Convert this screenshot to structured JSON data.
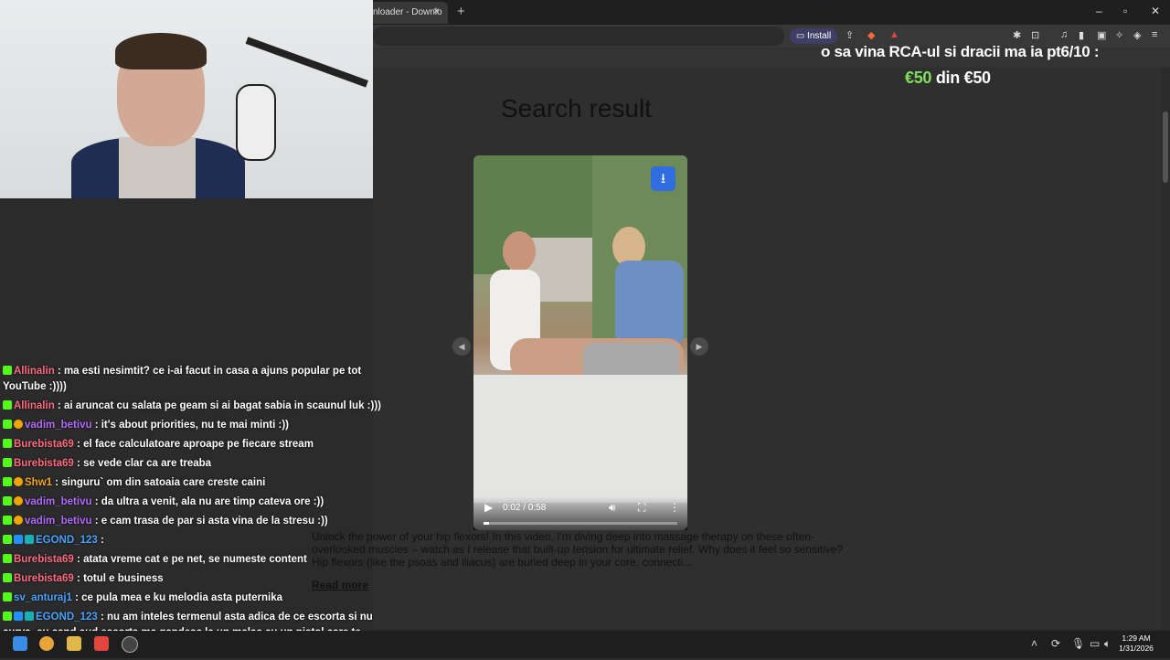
{
  "browser": {
    "tab_title": "nloader - Downlo",
    "tab_close": "×",
    "new_tab": "+",
    "window_controls": {
      "minimize": "–",
      "maximize": "▫",
      "close": "✕"
    },
    "install_label": "Install",
    "icons": [
      "share-icon",
      "brave-shields-icon",
      "brave-rewards-icon",
      "extensions-icon",
      "media-icon",
      "sidebar-icon",
      "wallet-icon",
      "leo-icon",
      "vpn-icon",
      "menu-icon"
    ]
  },
  "page": {
    "search_title": "Search result",
    "video": {
      "time": "0:02 / 0:58",
      "progress": 0.03,
      "download_icon": "download-icon"
    },
    "description": "Unlock the power of your hip flexors! In this video, I'm diving deep into massage therapy on these often-overlooked muscles – watch as I release that built-up tension for ultimate relief. Why does it feel so sensitive? Hip flexors (like the psoas and iliacus) are buried deep in your core, connecti...",
    "read_more": "Read more"
  },
  "overlay": {
    "donation_title": "o sa vina RCA-ul si dracii ma ia pt6/10 :",
    "donation_current": "€50",
    "donation_mid": " din ",
    "donation_goal": "€50"
  },
  "chat": [
    {
      "badges": [
        "k"
      ],
      "user": "Allinalin",
      "color": "#ff6b81",
      "text": " : ma esti nesimtit? ce i-ai facut in casa a ajuns popular pe tot YouTube :))))"
    },
    {
      "badges": [
        "k"
      ],
      "user": "Allinalin",
      "color": "#ff6b81",
      "text": " : ai aruncat cu salata pe geam si ai bagat sabia in scaunul luk :)))"
    },
    {
      "badges": [
        "k",
        "o"
      ],
      "user": "vadim_betivu",
      "color": "#b36bff",
      "text": " : it's about priorities, nu te mai minti :))"
    },
    {
      "badges": [
        "k"
      ],
      "user": "Burebista69",
      "color": "#ff6b81",
      "text": " : el face calculatoare aproape pe fiecare stream"
    },
    {
      "badges": [
        "k"
      ],
      "user": "Burebista69",
      "color": "#ff6b81",
      "text": " : se vede clar ca are treaba"
    },
    {
      "badges": [
        "k",
        "o"
      ],
      "user": "Shw1",
      "color": "#f5a623",
      "text": " : singuru` om din satoaia care creste caini"
    },
    {
      "badges": [
        "k",
        "o"
      ],
      "user": "vadim_betivu",
      "color": "#b36bff",
      "text": " : da ultra a venit, ala nu are timp cateva ore :))"
    },
    {
      "badges": [
        "k",
        "o"
      ],
      "user": "vadim_betivu",
      "color": "#b36bff",
      "text": " : e cam trasa de par si asta vina de la stresu :))"
    },
    {
      "badges": [
        "k",
        "b",
        "t"
      ],
      "user": "EGOND_123",
      "color": "#4aa3ff",
      "text": " : "
    },
    {
      "badges": [
        "k"
      ],
      "user": "Burebista69",
      "color": "#ff6b81",
      "text": " : atata vreme cat e pe net, se numeste content"
    },
    {
      "badges": [
        "k"
      ],
      "user": "Burebista69",
      "color": "#ff6b81",
      "text": " : totul e business"
    },
    {
      "badges": [
        "k"
      ],
      "user": "sv_anturaj1",
      "color": "#4aa3ff",
      "text": " : ce pula mea e ku melodia asta puternika"
    },
    {
      "badges": [
        "k",
        "b",
        "t"
      ],
      "user": "EGOND_123",
      "color": "#4aa3ff",
      "text": " : nu am inteles termenul asta adica de ce escorta si nu curva. eu cand aud escorta ma gandesc la un malac cu un pistol care te apara. da asta ce escorta ca e curva"
    }
  ],
  "taskbar": {
    "time": "1:29 AM",
    "date": "1/31/2026"
  }
}
